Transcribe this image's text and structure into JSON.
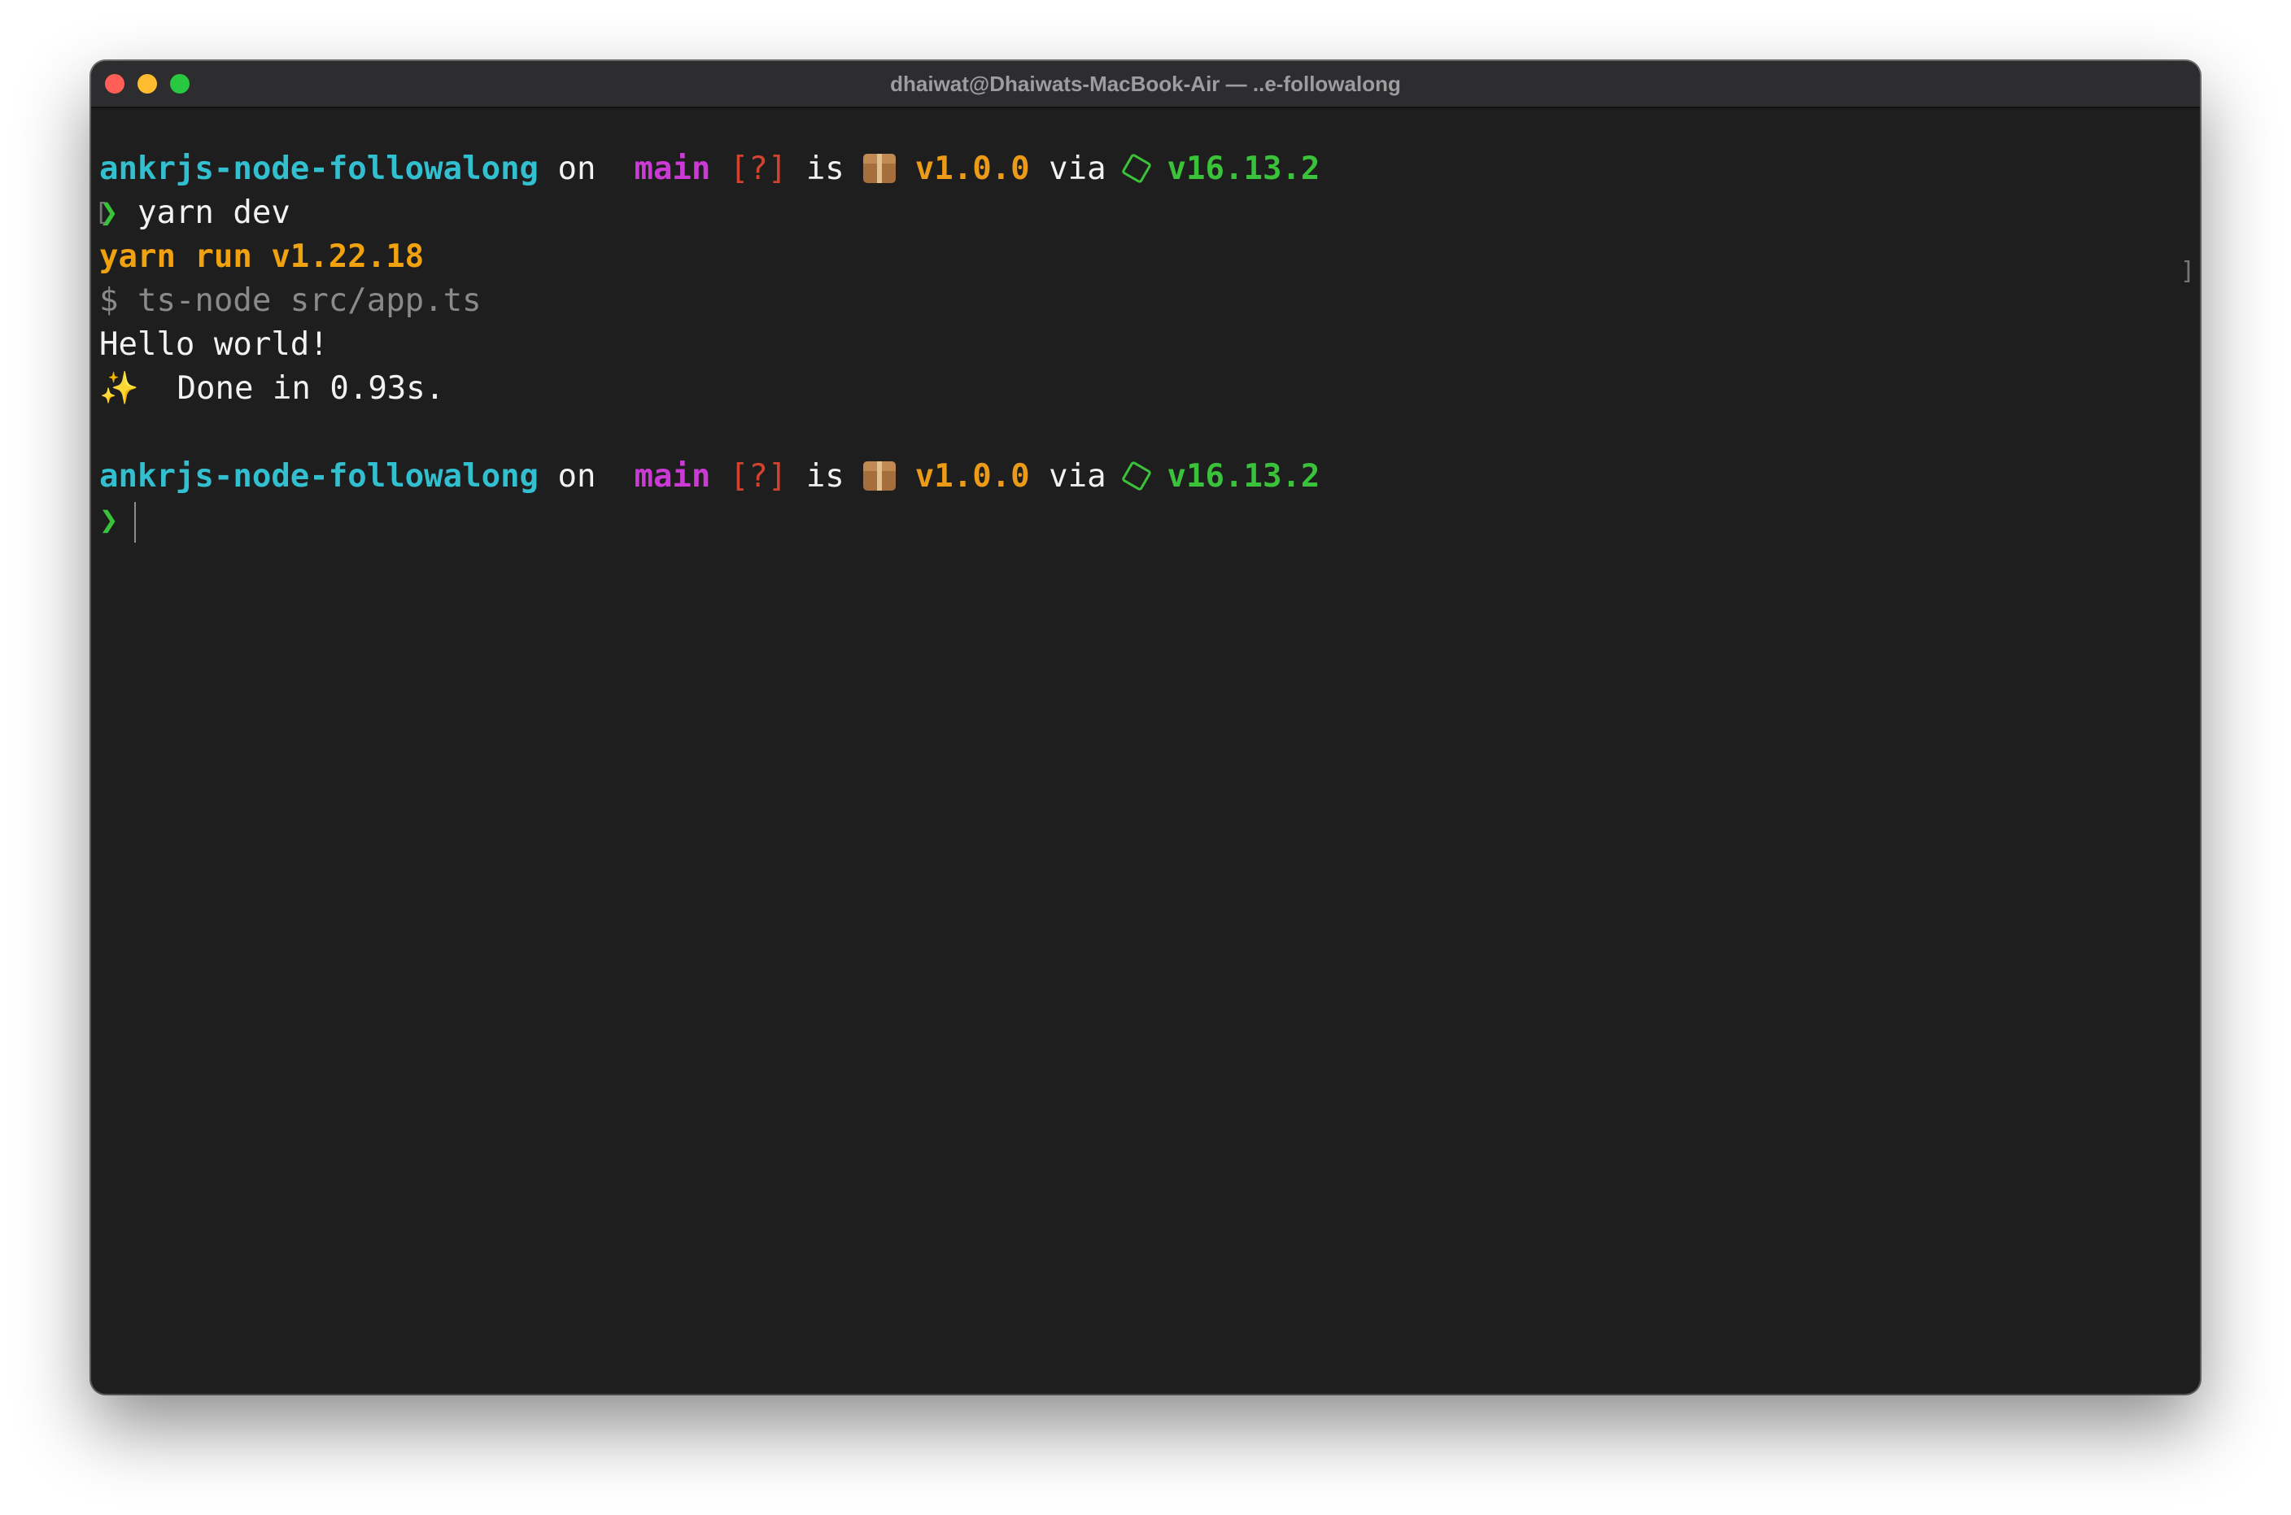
{
  "window": {
    "title": "dhaiwat@Dhaiwats-MacBook-Air — ..e-followalong"
  },
  "colors": {
    "directory": "#32bfcf",
    "branch": "#cc3ad6",
    "git_status": "#d2422d",
    "package_version": "#ec9b19",
    "node_version": "#3ac33a",
    "yarn_output": "#f0a20f",
    "command_echo": "#8a8a8a"
  },
  "icons": {
    "branch": "git-branch-icon",
    "package": "package-box-icon",
    "node": "node-hexagon-icon",
    "sparkles": "sparkles-icon"
  },
  "prompt": {
    "directory": "ankrjs-node-followalong",
    "on": "on",
    "branch_glyph": "",
    "branch": "main",
    "git_status": "[?]",
    "is": "is",
    "package_version": "v1.0.0",
    "via": "via",
    "node_version": "v16.13.2",
    "symbol": "❯"
  },
  "output": {
    "command": "yarn dev",
    "yarn_run": "yarn run v1.22.18",
    "script_echo": "$ ts-node src/app.ts",
    "hello": "Hello world!",
    "sparkles": "✨",
    "done": "Done in 0.93s."
  }
}
